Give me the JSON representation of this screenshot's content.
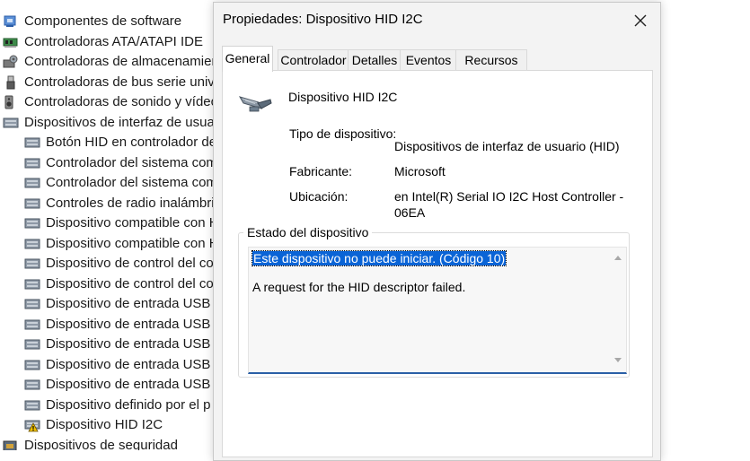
{
  "tree": {
    "items": [
      {
        "label": "Componentes de software",
        "icon": "component-icon",
        "level": 0
      },
      {
        "label": "Controladoras ATA/ATAPI IDE",
        "icon": "ide-controller-icon",
        "level": 0
      },
      {
        "label": "Controladoras de almacenamiento",
        "icon": "storage-controller-icon",
        "level": 0
      },
      {
        "label": "Controladoras de bus serie universal",
        "icon": "usb-icon",
        "level": 0
      },
      {
        "label": "Controladoras de sonido y vídeo",
        "icon": "speaker-icon",
        "level": 0
      },
      {
        "label": "Dispositivos de interfaz de usuario",
        "icon": "hid-icon",
        "level": 0
      },
      {
        "label": "Botón HID en controlador de",
        "icon": "hid-icon",
        "level": 1
      },
      {
        "label": "Controlador del sistema com",
        "icon": "hid-icon",
        "level": 1
      },
      {
        "label": "Controlador del sistema com",
        "icon": "hid-icon",
        "level": 1
      },
      {
        "label": "Controles de radio inalámbric",
        "icon": "hid-icon",
        "level": 1
      },
      {
        "label": "Dispositivo compatible con H",
        "icon": "hid-icon",
        "level": 1
      },
      {
        "label": "Dispositivo compatible con H",
        "icon": "hid-icon",
        "level": 1
      },
      {
        "label": "Dispositivo de control del co",
        "icon": "hid-icon",
        "level": 1
      },
      {
        "label": "Dispositivo de control del co",
        "icon": "hid-icon",
        "level": 1
      },
      {
        "label": "Dispositivo de entrada USB",
        "icon": "hid-icon",
        "level": 1
      },
      {
        "label": "Dispositivo de entrada USB",
        "icon": "hid-icon",
        "level": 1
      },
      {
        "label": "Dispositivo de entrada USB",
        "icon": "hid-icon",
        "level": 1
      },
      {
        "label": "Dispositivo de entrada USB",
        "icon": "hid-icon",
        "level": 1
      },
      {
        "label": "Dispositivo de entrada USB",
        "icon": "hid-icon",
        "level": 1
      },
      {
        "label": "Dispositivo definido por el p",
        "icon": "hid-icon",
        "level": 1
      },
      {
        "label": "Dispositivo HID I2C",
        "icon": "hid-warning-icon",
        "level": 1
      },
      {
        "label": "Dispositivos de seguridad",
        "icon": "security-icon",
        "level": 0
      }
    ]
  },
  "dialog": {
    "title": "Propiedades: Dispositivo HID I2C",
    "tabs": [
      "General",
      "Controlador",
      "Detalles",
      "Eventos",
      "Recursos"
    ],
    "active_tab": "General",
    "device_name": "Dispositivo HID I2C",
    "device_icon": "hid-device-icon",
    "type_label": "Tipo de dispositivo:",
    "type_value": "Dispositivos de interfaz de usuario (HID)",
    "manufacturer_label": "Fabricante:",
    "manufacturer_value": "Microsoft",
    "location_label": "Ubicación:",
    "location_value_line1": "en Intel(R) Serial IO I2C Host Controller -",
    "location_value_line2": "06EA",
    "status_group_label": "Estado del dispositivo",
    "status_line1": "Este dispositivo no puede iniciar. (Código 10)",
    "status_line2": "A request for the HID descriptor failed."
  },
  "colors": {
    "selection": "#0a64d6",
    "dialog_bg": "#f3f3f3",
    "panel_bg": "#ffffff",
    "focus_underline": "#2a5fa6",
    "warning": "#f2c200"
  }
}
